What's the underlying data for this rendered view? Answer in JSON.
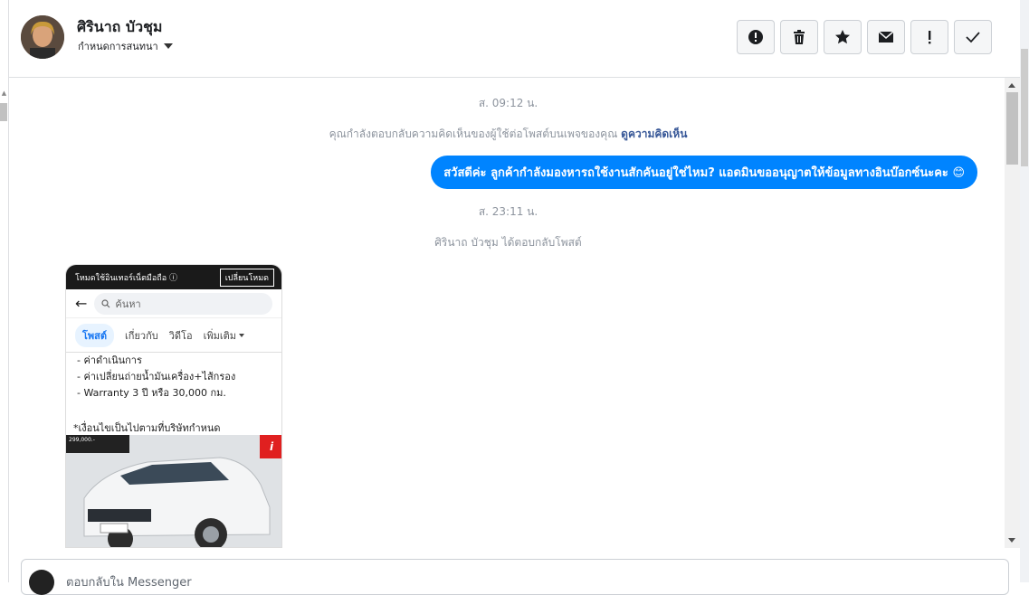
{
  "header": {
    "contact_name": "ศิรินาถ บัวชุม",
    "conversation_settings": "กำหนดการสนทนา",
    "actions": [
      {
        "icon": "alert-circle-icon",
        "label": ""
      },
      {
        "icon": "trash-icon",
        "label": ""
      },
      {
        "icon": "star-icon",
        "label": ""
      },
      {
        "icon": "envelope-icon",
        "label": ""
      },
      {
        "icon": "exclamation-icon",
        "label": ""
      },
      {
        "icon": "check-icon",
        "label": ""
      }
    ]
  },
  "thread": {
    "timestamp_1": "ส. 09:12 น.",
    "system_reply_text": "คุณกำลังตอบกลับความคิดเห็นของผู้ใช้ต่อโพสต์บนเพจของคุณ",
    "system_reply_link": "ดูความคิดเห็น",
    "outgoing_message": "สวัสดีค่ะ ลูกค้ากำลังมองหารถใช้งานสักคันอยู่ใช่ไหม? แอดมินขออนุญาตให้ข้อมูลทางอินบ๊อกซ์นะคะ 😊",
    "timestamp_2": "ส. 23:11 น.",
    "user_replied": "ศิรินาถ บัวชุม ได้ตอบกลับโพสต์"
  },
  "post_card": {
    "mode_text": "โหมดใช้อินเทอร์เน็ตมือถือ ⓘ",
    "switch_mode": "เปลี่ยนโหมด",
    "search_placeholder": "ค้นหา",
    "tabs": [
      "โพสต์",
      "เกี่ยวกับ",
      "วิดีโอ",
      "เพิ่มเติม"
    ],
    "lines": [
      "- ค่าดำเนินการ",
      "- ค่าเปลี่ยนถ่ายน้ำมันเครื่อง+ไส้กรอง",
      "- Warranty 3 ปี หรือ 30,000 กม."
    ],
    "note": "*เงื่อนไขเป็นไปตามที่บริษัทกำหนด",
    "price_tag": "299,000.-"
  },
  "composer": {
    "placeholder": "ตอบกลับใน Messenger"
  },
  "colors": {
    "accent": "#0084ff",
    "link": "#385898"
  }
}
